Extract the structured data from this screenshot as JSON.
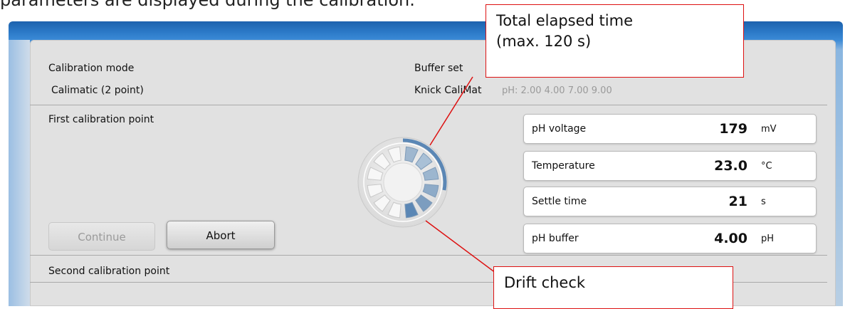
{
  "doc_caption": "parameters are displayed during the calibration.",
  "header": {
    "calibration_mode_label": "Calibration mode",
    "calibration_mode_value": "Calimatic (2 point)",
    "buffer_set_label": "Buffer set",
    "buffer_set_value": "Knick CaliMat",
    "buffer_values": "pH: 2.00  4.00  7.00  9.00"
  },
  "first_point": {
    "title": "First calibration point",
    "continue_label": "Continue",
    "abort_label": "Abort",
    "readings": [
      {
        "label": "pH voltage",
        "value": "179",
        "unit": "mV"
      },
      {
        "label": "Temperature",
        "value": "23.0",
        "unit": "°C"
      },
      {
        "label": "Settle time",
        "value": "21",
        "unit": "s"
      },
      {
        "label": "pH buffer",
        "value": "4.00",
        "unit": "pH"
      }
    ]
  },
  "second_point": {
    "title": "Second calibration point"
  },
  "annotations": {
    "elapsed_line1": "Total elapsed time",
    "elapsed_line2": "(max. 120 s)",
    "drift": "Drift check"
  },
  "colors": {
    "annotation_red": "#dd1111",
    "frame_blue": "#2a78c6",
    "spinner_active": "#5b87b5"
  },
  "spinner": {
    "segments_total": 12,
    "drift_segments_filled": 6,
    "elapsed_fraction": 0.28
  }
}
